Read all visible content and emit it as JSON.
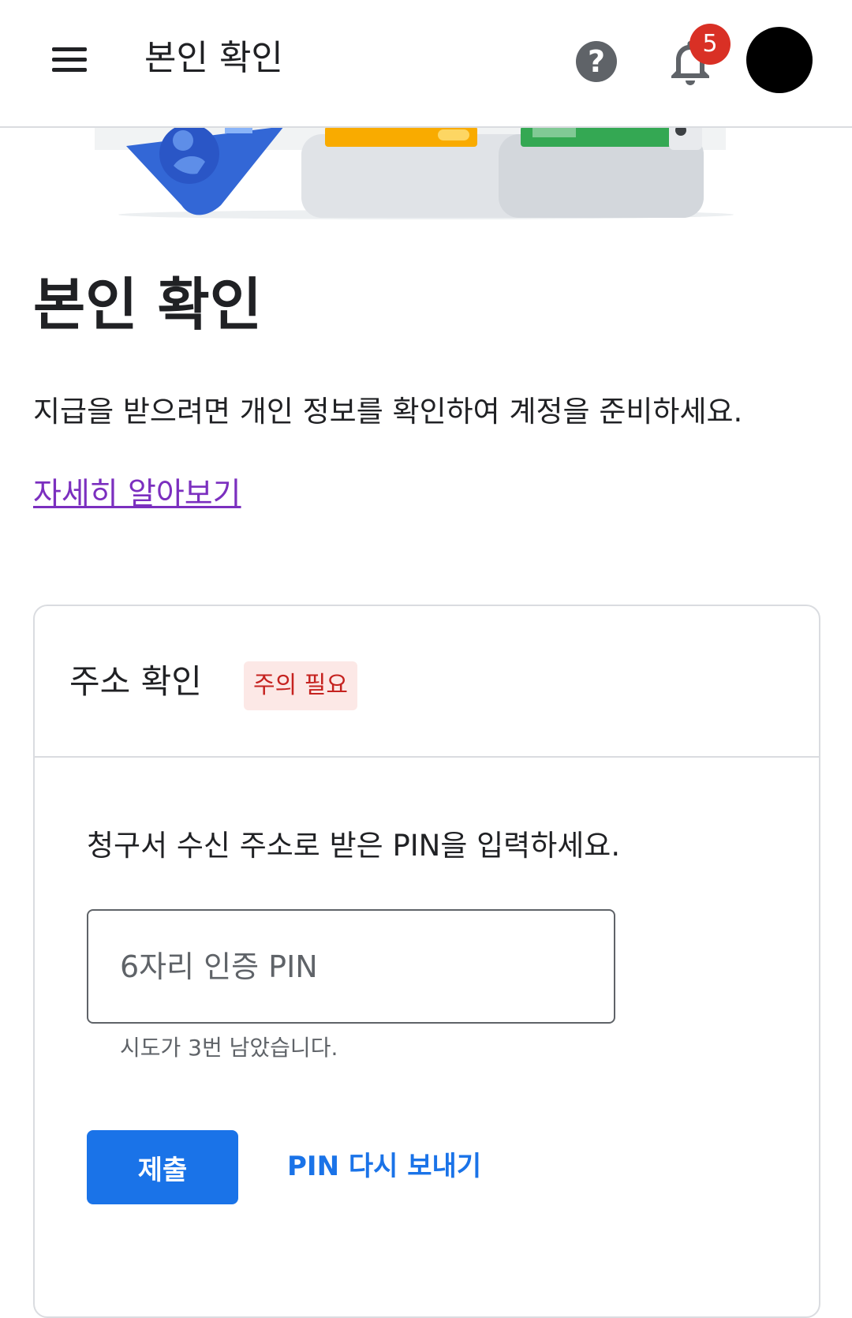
{
  "topbar": {
    "title": "본인 확인",
    "help_glyph": "?",
    "notification_count": "5",
    "icons": [
      "menu-icon",
      "help-icon",
      "bell-icon",
      "avatar"
    ]
  },
  "main": {
    "title": "본인 확인",
    "description": "지급을 받으려면 개인 정보를 확인하여 계정을 준비하세요.",
    "learn_more": "자세히 알아보기"
  },
  "card": {
    "title": "주소 확인",
    "status_chip": "주의 필요",
    "instruction": "청구서 수신 주소로 받은 PIN을 입력하세요.",
    "pin_input": {
      "placeholder": "6자리 인증 PIN",
      "value": ""
    },
    "attempts_text": "시도가 3번 남았습니다.",
    "submit_label": "제출",
    "resend_label": "PIN 다시 보내기"
  },
  "colors": {
    "primary": "#1a73e8",
    "link_visited": "#7b2fbf",
    "badge": "#d93025",
    "chip_bg": "#fce8e6",
    "chip_text": "#c5221f"
  }
}
